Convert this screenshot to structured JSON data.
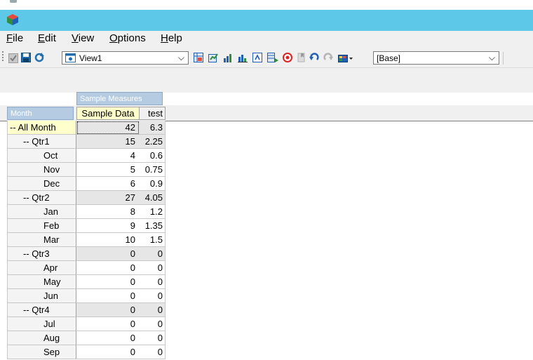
{
  "menu": {
    "items": [
      {
        "accel": "F",
        "rest": "ile"
      },
      {
        "accel": "E",
        "rest": "dit"
      },
      {
        "accel": "V",
        "rest": "iew"
      },
      {
        "accel": "O",
        "rest": "ptions"
      },
      {
        "accel": "H",
        "rest": "elp"
      }
    ]
  },
  "toolbar": {
    "view_select": "View1",
    "base_select": "[Base]"
  },
  "grid": {
    "measures_label": "Sample Measures",
    "dimension_label": "Month",
    "columns": [
      "Sample Data",
      "test"
    ],
    "rows": [
      {
        "label": "-- All Month",
        "level": 0,
        "v1": "42",
        "v2": "6.3"
      },
      {
        "label": "-- Qtr1",
        "level": 1,
        "v1": "15",
        "v2": "2.25"
      },
      {
        "label": "Oct",
        "level": 2,
        "v1": "4",
        "v2": "0.6"
      },
      {
        "label": "Nov",
        "level": 2,
        "v1": "5",
        "v2": "0.75"
      },
      {
        "label": "Dec",
        "level": 2,
        "v1": "6",
        "v2": "0.9"
      },
      {
        "label": "-- Qtr2",
        "level": 1,
        "v1": "27",
        "v2": "4.05"
      },
      {
        "label": "Jan",
        "level": 2,
        "v1": "8",
        "v2": "1.2"
      },
      {
        "label": "Feb",
        "level": 2,
        "v1": "9",
        "v2": "1.35"
      },
      {
        "label": "Mar",
        "level": 2,
        "v1": "10",
        "v2": "1.5"
      },
      {
        "label": "-- Qtr3",
        "level": 1,
        "v1": "0",
        "v2": "0"
      },
      {
        "label": "Apr",
        "level": 2,
        "v1": "0",
        "v2": "0"
      },
      {
        "label": "May",
        "level": 2,
        "v1": "0",
        "v2": "0"
      },
      {
        "label": "Jun",
        "level": 2,
        "v1": "0",
        "v2": "0"
      },
      {
        "label": "-- Qtr4",
        "level": 1,
        "v1": "0",
        "v2": "0"
      },
      {
        "label": "Jul",
        "level": 2,
        "v1": "0",
        "v2": "0"
      },
      {
        "label": "Aug",
        "level": 2,
        "v1": "0",
        "v2": "0"
      },
      {
        "label": "Sep",
        "level": 2,
        "v1": "0",
        "v2": "0"
      }
    ]
  },
  "colors": {
    "titlebar": "#5ec8e9",
    "header_blue": "#b5cbe2",
    "highlight": "#ffffcc",
    "aggregate_row": "#e6e6e6"
  }
}
